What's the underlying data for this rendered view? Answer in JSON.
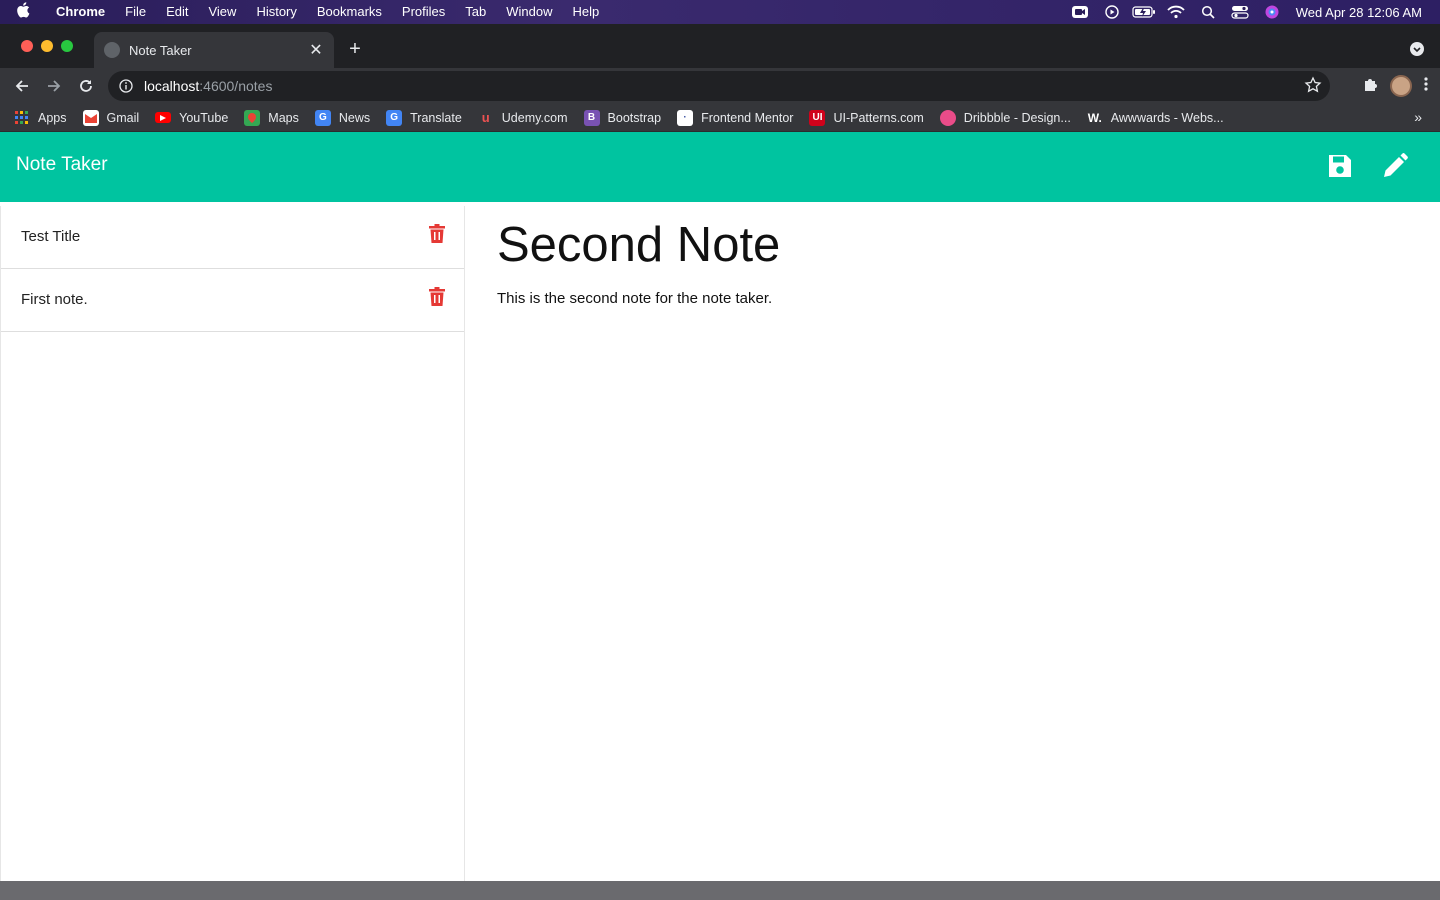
{
  "menubar": {
    "app": "Chrome",
    "items": [
      "File",
      "Edit",
      "View",
      "History",
      "Bookmarks",
      "Profiles",
      "Tab",
      "Window",
      "Help"
    ],
    "clock": "Wed Apr 28  12:06 AM"
  },
  "browser": {
    "tab_title": "Note Taker",
    "url_host": "localhost",
    "url_path": ":4600/notes",
    "bookmarks": [
      {
        "label": "Apps",
        "icon": "apps-grid-icon",
        "color": "#4285f4"
      },
      {
        "label": "Gmail",
        "icon": "gmail-icon",
        "color": "#ea4335"
      },
      {
        "label": "YouTube",
        "icon": "youtube-icon",
        "color": "#ff0000"
      },
      {
        "label": "Maps",
        "icon": "maps-icon",
        "color": "#34a853"
      },
      {
        "label": "News",
        "icon": "news-icon",
        "color": "#4285f4"
      },
      {
        "label": "Translate",
        "icon": "translate-icon",
        "color": "#4285f4"
      },
      {
        "label": "Udemy.com",
        "icon": "udemy-icon",
        "color": "#ec5252"
      },
      {
        "label": "Bootstrap",
        "icon": "bootstrap-icon",
        "color": "#7952b3"
      },
      {
        "label": "Frontend Mentor",
        "icon": "frontend-mentor-icon",
        "color": "#ffffff"
      },
      {
        "label": "UI-Patterns.com",
        "icon": "ui-patterns-icon",
        "color": "#d0021b"
      },
      {
        "label": "Dribbble - Design...",
        "icon": "dribbble-icon",
        "color": "#ea4c89"
      },
      {
        "label": "Awwwards - Webs...",
        "icon": "awwwards-icon",
        "color": "#222222"
      }
    ]
  },
  "app": {
    "brand": "Note Taker",
    "accent": "#00c4a0",
    "notes": [
      {
        "title": "Test Title"
      },
      {
        "title": "First note."
      }
    ],
    "active_note": {
      "title": "Second Note",
      "text": "This is the second note for the note taker."
    }
  }
}
